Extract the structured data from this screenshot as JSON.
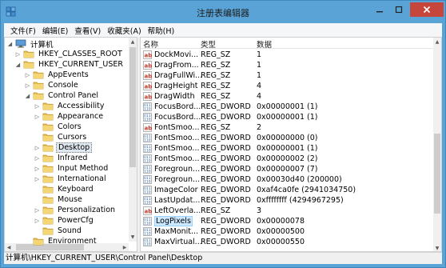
{
  "window": {
    "title": "注册表编辑器",
    "accent": "#5aa3d6",
    "close_color": "#c7463c"
  },
  "menu": [
    "文件(F)",
    "编辑(E)",
    "查看(V)",
    "收藏夹(A)",
    "帮助(H)"
  ],
  "tree": {
    "items": [
      {
        "label": "计算机",
        "expanded": true,
        "icon": "computer-icon"
      },
      {
        "label": "HKEY_CLASSES_ROOT",
        "expanded": false,
        "icon": "folder-icon"
      },
      {
        "label": "HKEY_CURRENT_USER",
        "expanded": true,
        "icon": "folder-icon"
      },
      {
        "label": "AppEvents",
        "expanded": false,
        "icon": "folder-icon"
      },
      {
        "label": "Console",
        "expanded": false,
        "icon": "folder-icon"
      },
      {
        "label": "Control Panel",
        "expanded": true,
        "icon": "folder-icon"
      },
      {
        "label": "Accessibility",
        "expanded": false,
        "icon": "folder-icon"
      },
      {
        "label": "Appearance",
        "expanded": false,
        "icon": "folder-icon"
      },
      {
        "label": "Colors",
        "expanded": null,
        "icon": "folder-icon"
      },
      {
        "label": "Cursors",
        "expanded": null,
        "icon": "folder-icon"
      },
      {
        "label": "Desktop",
        "expanded": false,
        "icon": "folder-icon",
        "selected": true
      },
      {
        "label": "Infrared",
        "expanded": false,
        "icon": "folder-icon"
      },
      {
        "label": "Input Method",
        "expanded": false,
        "icon": "folder-icon"
      },
      {
        "label": "International",
        "expanded": false,
        "icon": "folder-icon"
      },
      {
        "label": "Keyboard",
        "expanded": null,
        "icon": "folder-icon"
      },
      {
        "label": "Mouse",
        "expanded": null,
        "icon": "folder-icon"
      },
      {
        "label": "Personalization",
        "expanded": false,
        "icon": "folder-icon"
      },
      {
        "label": "PowerCfg",
        "expanded": false,
        "icon": "folder-icon"
      },
      {
        "label": "Sound",
        "expanded": null,
        "icon": "folder-icon"
      },
      {
        "label": "Environment",
        "expanded": null,
        "icon": "folder-icon"
      }
    ]
  },
  "list": {
    "headers": {
      "name": "名称",
      "type": "类型",
      "data": "数据"
    },
    "rows": [
      {
        "name": "DockMovi...",
        "type": "REG_SZ",
        "data": "1",
        "kind": "sz"
      },
      {
        "name": "DragFrom...",
        "type": "REG_SZ",
        "data": "1",
        "kind": "sz"
      },
      {
        "name": "DragFullWi...",
        "type": "REG_SZ",
        "data": "1",
        "kind": "sz"
      },
      {
        "name": "DragHeight",
        "type": "REG_SZ",
        "data": "4",
        "kind": "sz"
      },
      {
        "name": "DragWidth",
        "type": "REG_SZ",
        "data": "4",
        "kind": "sz"
      },
      {
        "name": "FocusBord...",
        "type": "REG_DWORD",
        "data": "0x00000001 (1)",
        "kind": "dword"
      },
      {
        "name": "FocusBord...",
        "type": "REG_DWORD",
        "data": "0x00000001 (1)",
        "kind": "dword"
      },
      {
        "name": "FontSmoo...",
        "type": "REG_SZ",
        "data": "2",
        "kind": "sz"
      },
      {
        "name": "FontSmoo...",
        "type": "REG_DWORD",
        "data": "0x00000000 (0)",
        "kind": "dword"
      },
      {
        "name": "FontSmoo...",
        "type": "REG_DWORD",
        "data": "0x00000001 (1)",
        "kind": "dword"
      },
      {
        "name": "FontSmoo...",
        "type": "REG_DWORD",
        "data": "0x00000002 (2)",
        "kind": "dword"
      },
      {
        "name": "Foregroun...",
        "type": "REG_DWORD",
        "data": "0x00000007 (7)",
        "kind": "dword"
      },
      {
        "name": "Foregroun...",
        "type": "REG_DWORD",
        "data": "0x00030d40 (200000)",
        "kind": "dword"
      },
      {
        "name": "ImageColor",
        "type": "REG_DWORD",
        "data": "0xaf4ca0fe (2941034750)",
        "kind": "dword"
      },
      {
        "name": "LastUpdat...",
        "type": "REG_DWORD",
        "data": "0xffffffff (4294967295)",
        "kind": "dword"
      },
      {
        "name": "LeftOverla...",
        "type": "REG_SZ",
        "data": "3",
        "kind": "sz"
      },
      {
        "name": "LogPixels",
        "type": "REG_DWORD",
        "data": "0x00000078",
        "kind": "dword",
        "selected": true
      },
      {
        "name": "MaxMonit...",
        "type": "REG_DWORD",
        "data": "0x00000500",
        "kind": "dword"
      },
      {
        "name": "MaxVirtual...",
        "type": "REG_DWORD",
        "data": "0x00000550",
        "kind": "dword"
      }
    ]
  },
  "status": {
    "path": "计算机\\HKEY_CURRENT_USER\\Control Panel\\Desktop"
  }
}
